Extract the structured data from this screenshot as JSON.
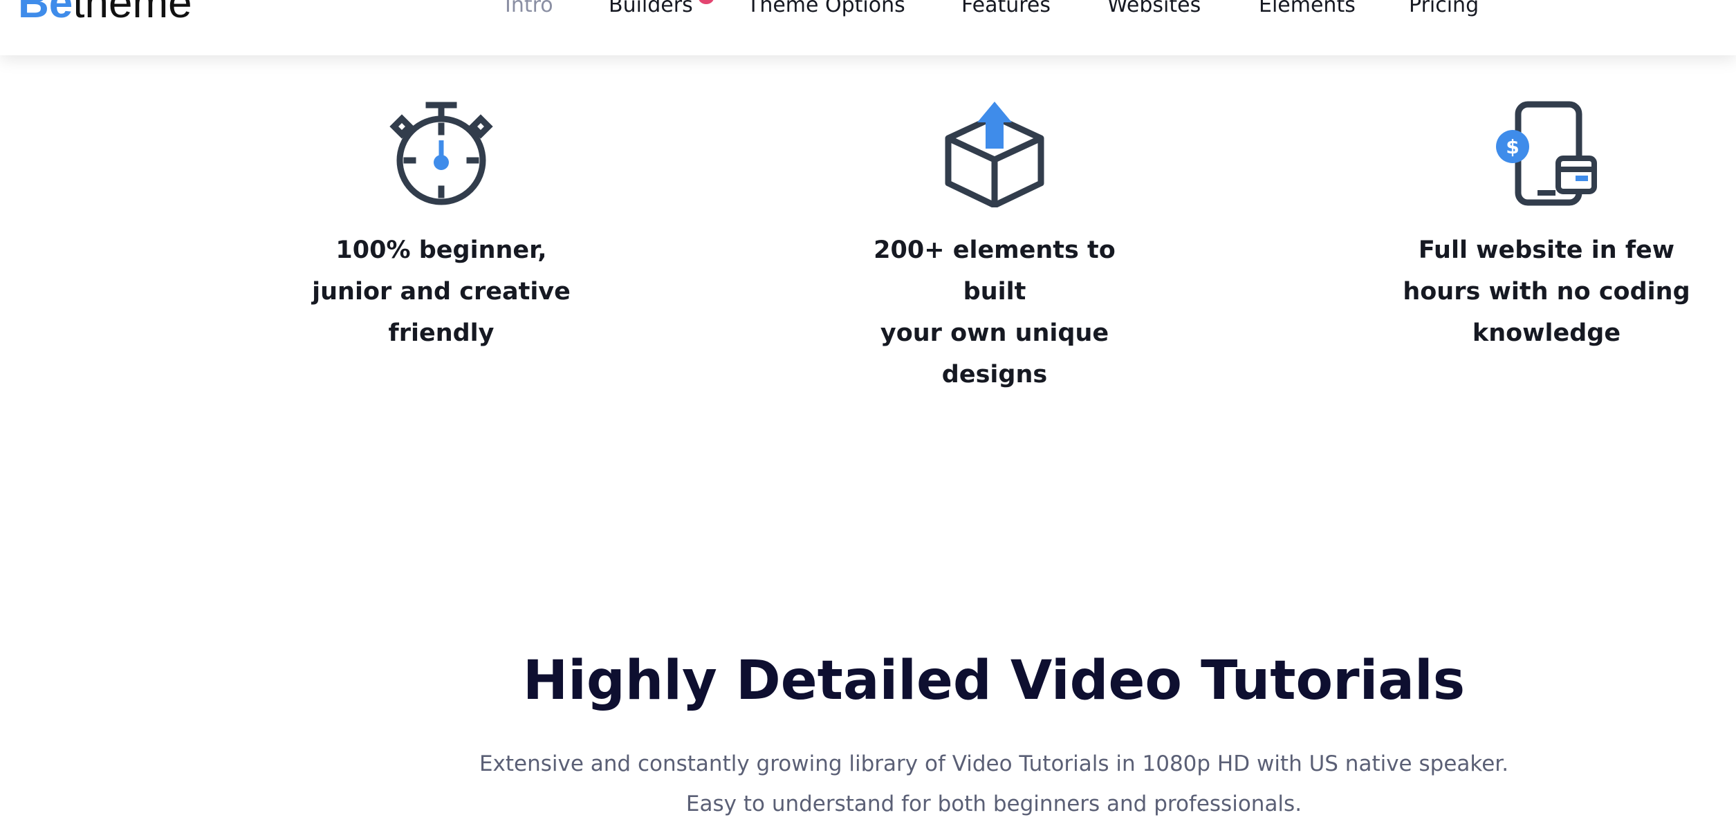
{
  "header": {
    "logo": {
      "prefix": "Be",
      "suffix": "theme"
    },
    "nav": [
      {
        "label": "Intro"
      },
      {
        "label": "Builders"
      },
      {
        "label": "Theme Options"
      },
      {
        "label": "Features"
      },
      {
        "label": "Websites"
      },
      {
        "label": "Elements"
      },
      {
        "label": "Pricing"
      }
    ]
  },
  "features": [
    {
      "icon": "stopwatch-icon",
      "line1": "100% beginner,",
      "line2": "junior and creative",
      "line3": "friendly"
    },
    {
      "icon": "box-upload-icon",
      "line1": "200+ elements to built",
      "line2": "your own unique",
      "line3": "designs"
    },
    {
      "icon": "mobile-payment-icon",
      "line1": "Full website in few",
      "line2": "hours with no coding",
      "line3": "knowledge"
    }
  ],
  "tutorials": {
    "title": "Highly Detailed Video Tutorials",
    "description_line1": "Extensive and constantly growing library of Video Tutorials in 1080p HD with US native speaker.",
    "description_line2": "Easy to understand for both beginners and professionals."
  },
  "colors": {
    "accent": "#3f8cea",
    "icon_dark": "#323d4c",
    "heading": "#0e0f30",
    "badge": "#e34570"
  }
}
